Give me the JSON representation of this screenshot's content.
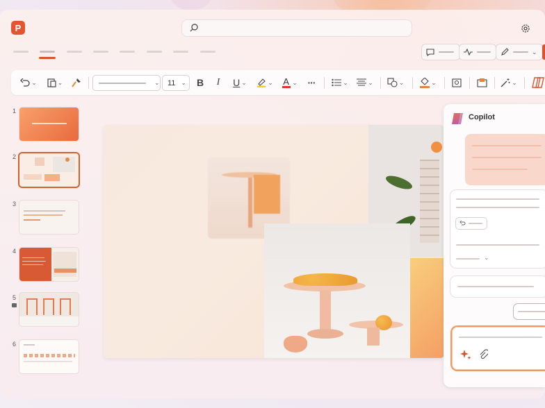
{
  "app": {
    "logo_letter": "P",
    "accent": "#d9542e"
  },
  "search": {
    "icon": "search-icon",
    "placeholder": ""
  },
  "ribbon": {
    "font_size": "11",
    "bold": "B",
    "italic": "I",
    "underline": "U",
    "more": "···",
    "font_color_letter": "A"
  },
  "thumbnails": [
    {
      "number": "1"
    },
    {
      "number": "2"
    },
    {
      "number": "3"
    },
    {
      "number": "4"
    },
    {
      "number": "5"
    },
    {
      "number": "6"
    }
  ],
  "copilot": {
    "title": "Copilot",
    "accent_gradient": [
      "#f0783a",
      "#a04fd6"
    ]
  }
}
